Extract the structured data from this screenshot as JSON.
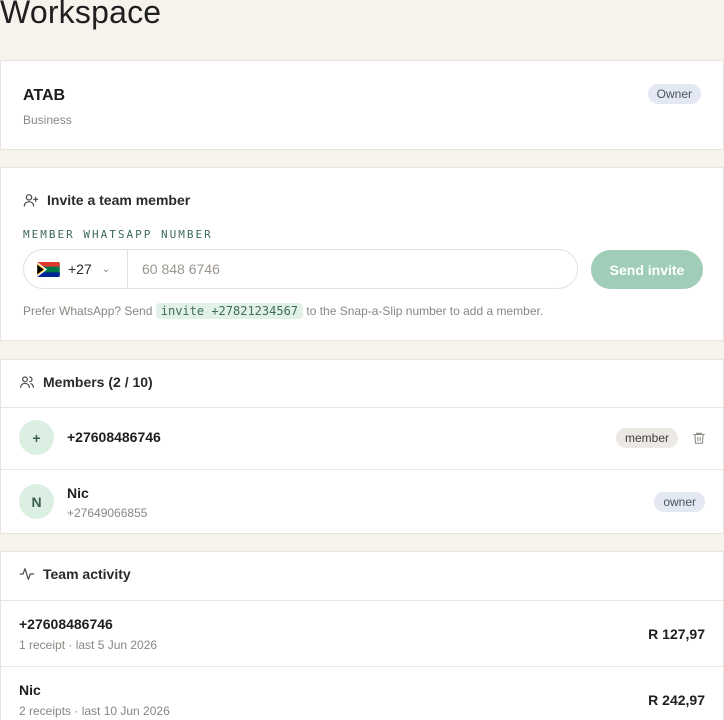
{
  "page": {
    "title": "Workspace"
  },
  "workspace": {
    "name": "ATAB",
    "type": "Business",
    "role_badge": "Owner"
  },
  "invite": {
    "heading": "Invite a team member",
    "field_label": "MEMBER WHATSAPP NUMBER",
    "country_code": "+27",
    "country_flag": "south-africa-flag",
    "phone_placeholder": "60 848 6746",
    "send_label": "Send invite",
    "hint_prefix": "Prefer WhatsApp? Send",
    "hint_code": "invite +27821234567",
    "hint_suffix": "to the Snap-a-Slip number to add a member."
  },
  "members": {
    "heading": "Members (2 / 10)",
    "items": [
      {
        "initial": "+",
        "name": "+27608486746",
        "sub": "",
        "role": "member",
        "removable": true
      },
      {
        "initial": "N",
        "name": "Nic",
        "sub": "+27649066855",
        "role": "owner",
        "removable": false
      }
    ]
  },
  "activity": {
    "heading": "Team activity",
    "items": [
      {
        "name": "+27608486746",
        "meta": "1 receipt · last 5 Jun 2026",
        "amount": "R 127,97"
      },
      {
        "name": "Nic",
        "meta": "2 receipts · last 10 Jun 2026",
        "amount": "R 242,97"
      }
    ]
  },
  "colors": {
    "background": "#f6f2ec",
    "accent_green": "#9fcdb7",
    "owner_badge": "#e3e8f3",
    "avatar_bg": "#dcefe3"
  }
}
